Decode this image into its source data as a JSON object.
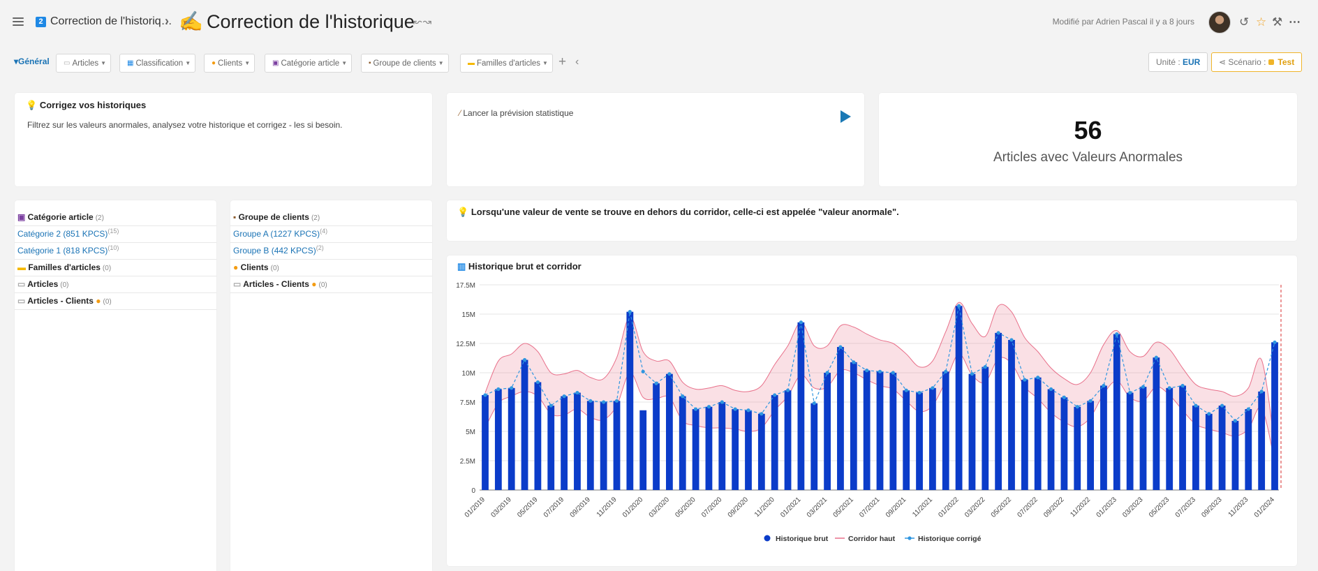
{
  "header": {
    "breadcrumb_badge": "2",
    "breadcrumb": "Correction de l'historiq…",
    "separator": "›",
    "title_emoji": "✍",
    "title": "Correction de l'historique",
    "title_arrows": "↜↝",
    "modified": "Modifié par Adrien Pascal il y a 8 jours",
    "icons": [
      "menu-icon",
      "history-icon",
      "star-icon",
      "tools-icon",
      "more-icon"
    ]
  },
  "filters": {
    "general": "Général",
    "chips": [
      {
        "icon": "▭",
        "label": "Articles"
      },
      {
        "icon": "▦",
        "label": "Classification"
      },
      {
        "icon": "●",
        "label": "Clients"
      },
      {
        "icon": "▣",
        "label": "Catégorie article"
      },
      {
        "icon": "▪",
        "label": "Groupe de clients"
      },
      {
        "icon": "▬",
        "label": "Familles d'articles"
      }
    ],
    "unit_label": "Unité : ",
    "unit_value": "EUR",
    "scenario_label": "Scénario :",
    "scenario_value": "Test"
  },
  "cards": {
    "info_title": "Corrigez vos historiques",
    "info_text": "Filtrez sur les valeurs anormales, analysez votre historique et corrigez - les si besoin.",
    "launch_label": "Lancer la prévision statistique",
    "kpi_value": "56",
    "kpi_label": "Articles avec Valeurs Anormales",
    "note": "Lorsqu'une valeur de vente se trouve en dehors du corridor, celle-ci est appelée \"valeur anormale\"."
  },
  "tree1": [
    {
      "type": "hd",
      "label": "Catégorie article",
      "count": "(2)"
    },
    {
      "type": "lnk",
      "label": "Catégorie 2 (851 KPCS)",
      "sup": "(15)"
    },
    {
      "type": "lnk",
      "label": "Catégorie 1 (818 KPCS)",
      "sup": "(10)"
    },
    {
      "type": "hd",
      "label": "Familles d'articles",
      "count": "(0)"
    },
    {
      "type": "hd",
      "label": "Articles",
      "count": "(0)"
    },
    {
      "type": "hd",
      "label": "Articles - Clients",
      "count": "(0)"
    }
  ],
  "tree2": [
    {
      "type": "hd",
      "label": "Groupe de clients",
      "count": "(2)"
    },
    {
      "type": "lnk",
      "label": "Groupe A (1227 KPCS)",
      "sup": "(4)"
    },
    {
      "type": "lnk",
      "label": "Groupe B (442 KPCS)",
      "sup": "(2)"
    },
    {
      "type": "hd",
      "label": "Clients",
      "count": "(0)"
    },
    {
      "type": "hd",
      "label": "Articles - Clients",
      "count": "(0)"
    }
  ],
  "chart_data": {
    "type": "bar",
    "title": "Historique brut et corridor",
    "x_labels": [
      "01/2019",
      "02/2019",
      "03/2019",
      "04/2019",
      "05/2019",
      "06/2019",
      "07/2019",
      "08/2019",
      "09/2019",
      "10/2019",
      "11/2019",
      "12/2019",
      "01/2020",
      "02/2020",
      "03/2020",
      "04/2020",
      "05/2020",
      "06/2020",
      "07/2020",
      "08/2020",
      "09/2020",
      "10/2020",
      "11/2020",
      "12/2020",
      "01/2021",
      "02/2021",
      "03/2021",
      "04/2021",
      "05/2021",
      "06/2021",
      "07/2021",
      "08/2021",
      "09/2021",
      "10/2021",
      "11/2021",
      "12/2021",
      "01/2022",
      "02/2022",
      "03/2022",
      "04/2022",
      "05/2022",
      "06/2022",
      "07/2022",
      "08/2022",
      "09/2022",
      "10/2022",
      "11/2022",
      "12/2022",
      "01/2023",
      "02/2023",
      "03/2023",
      "04/2023",
      "05/2023",
      "06/2023",
      "07/2023",
      "08/2023",
      "09/2023",
      "10/2023",
      "11/2023",
      "12/2023",
      "01/2024"
    ],
    "tick_every": 2,
    "ylim": [
      0,
      17500000
    ],
    "yticks": [
      "0",
      "2.5M",
      "5M",
      "7.5M",
      "10M",
      "12.5M",
      "15M",
      "17.5M"
    ],
    "ytick_values": [
      0,
      2500000,
      5000000,
      7500000,
      10000000,
      12500000,
      15000000,
      17500000
    ],
    "series": [
      {
        "name": "Historique brut",
        "type": "bar",
        "color": "#0b3cc9",
        "values": [
          8.1,
          8.6,
          8.7,
          11.1,
          9.2,
          7.2,
          8.0,
          8.3,
          7.6,
          7.5,
          7.6,
          15.2,
          6.8,
          9.1,
          9.9,
          8.0,
          6.9,
          7.1,
          7.5,
          6.9,
          6.8,
          6.5,
          8.1,
          8.5,
          14.3,
          7.4,
          10.0,
          12.2,
          10.9,
          10.2,
          10.1,
          10.0,
          8.5,
          8.3,
          8.7,
          10.1,
          15.7,
          9.9,
          10.5,
          13.4,
          12.8,
          9.4,
          9.6,
          8.6,
          7.9,
          7.1,
          7.6,
          8.9,
          13.3,
          8.3,
          8.8,
          11.3,
          8.7,
          8.9,
          7.2,
          6.5,
          7.2,
          5.9,
          6.9,
          8.4,
          12.6
        ]
      },
      {
        "name": "Corridor haut",
        "type": "area-line",
        "color": "#e8708a",
        "values": [
          8.3,
          11.0,
          11.6,
          12.5,
          11.8,
          10.0,
          9.9,
          10.2,
          9.6,
          9.5,
          11.3,
          14.8,
          11.8,
          11.0,
          11.0,
          9.2,
          8.6,
          8.7,
          8.9,
          8.5,
          8.4,
          8.9,
          10.7,
          12.3,
          14.3,
          12.3,
          12.3,
          14.0,
          13.9,
          13.3,
          12.8,
          12.5,
          11.6,
          10.5,
          11.0,
          13.5,
          16.0,
          14.2,
          13.1,
          15.7,
          15.2,
          13.0,
          11.8,
          10.4,
          9.5,
          9.0,
          10.0,
          12.4,
          13.6,
          11.8,
          11.4,
          12.6,
          12.0,
          10.4,
          9.0,
          8.6,
          8.4,
          8.0,
          8.7,
          11.1,
          3.8
        ]
      },
      {
        "name": "Corridor bas",
        "type": "area-line",
        "color": "#e8708a",
        "values": [
          5.3,
          7.4,
          8.0,
          8.4,
          8.0,
          6.5,
          6.4,
          6.9,
          6.2,
          6.0,
          7.2,
          10.0,
          7.9,
          7.8,
          7.9,
          5.9,
          5.5,
          5.3,
          5.3,
          5.2,
          5.0,
          5.3,
          6.8,
          8.0,
          9.8,
          8.7,
          8.8,
          10.2,
          10.0,
          9.4,
          8.9,
          8.6,
          7.6,
          6.7,
          7.2,
          9.3,
          11.6,
          9.8,
          9.2,
          11.2,
          10.8,
          8.8,
          7.8,
          6.6,
          5.8,
          5.4,
          6.2,
          8.2,
          9.3,
          7.9,
          7.6,
          8.8,
          8.1,
          6.8,
          5.6,
          5.2,
          4.9,
          4.6,
          5.2,
          7.0,
          2.4
        ]
      },
      {
        "name": "Historique corrigé",
        "type": "line",
        "color": "#2f96e0",
        "values": [
          8.1,
          8.6,
          8.7,
          11.1,
          9.2,
          7.2,
          8.0,
          8.3,
          7.6,
          7.5,
          7.6,
          15.2,
          10.1,
          9.1,
          9.9,
          8.0,
          6.9,
          7.1,
          7.5,
          6.9,
          6.8,
          6.5,
          8.1,
          8.5,
          14.3,
          7.4,
          10.0,
          12.2,
          10.9,
          10.2,
          10.1,
          10.0,
          8.5,
          8.3,
          8.7,
          10.1,
          15.7,
          9.9,
          10.5,
          13.4,
          12.8,
          9.4,
          9.6,
          8.6,
          7.9,
          7.1,
          7.6,
          8.9,
          13.3,
          8.3,
          8.8,
          11.3,
          8.7,
          8.9,
          7.2,
          6.5,
          7.2,
          5.9,
          6.9,
          8.4,
          12.6
        ]
      }
    ],
    "value_scale": "millions",
    "legend": [
      "Historique brut",
      "Corridor haut",
      "Historique corrigé"
    ],
    "legend_position": "bottom-center",
    "marker_line": {
      "at": "01/2024",
      "color": "#e05050",
      "style": "dashed"
    },
    "grid": true
  }
}
